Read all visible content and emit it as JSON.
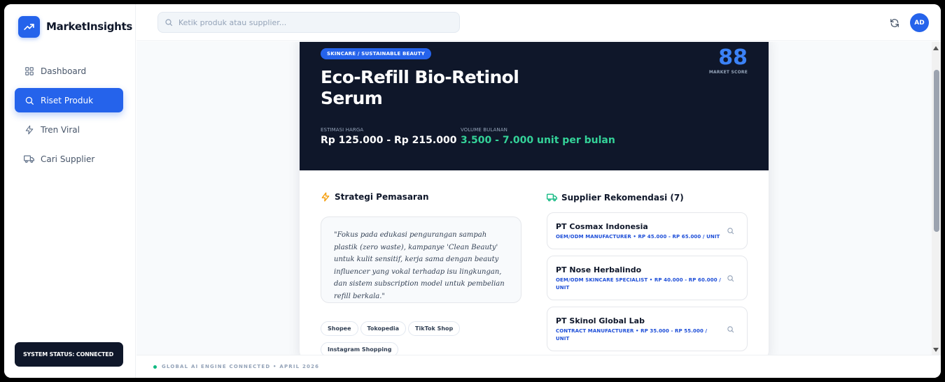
{
  "app": {
    "name": "MarketInsights"
  },
  "sidebar": {
    "items": [
      {
        "label": "Dashboard",
        "icon": "grid-icon",
        "active": false
      },
      {
        "label": "Riset Produk",
        "icon": "search-icon",
        "active": true
      },
      {
        "label": "Tren Viral",
        "icon": "lightning-icon",
        "active": false
      },
      {
        "label": "Cari Supplier",
        "icon": "truck-icon",
        "active": false
      }
    ],
    "system_status": "SYSTEM STATUS: CONNECTED"
  },
  "topbar": {
    "search_placeholder": "Ketik produk atau supplier...",
    "avatar_initials": "AD"
  },
  "product": {
    "category": "SKINCARE / SUSTAINABLE BEAUTY",
    "title": "Eco-Refill Bio-Retinol Serum",
    "market_score": "88",
    "market_score_label": "MARKET SCORE",
    "price_label": "ESTIMASI HARGA",
    "price_value": "Rp 125.000 - Rp 215.000",
    "volume_label": "VOLUME BULANAN",
    "volume_value": "3.500 - 7.000 unit per bulan"
  },
  "strategy": {
    "heading": "Strategi Pemasaran",
    "text": "\"Fokus pada edukasi pengurangan sampah plastik (zero waste), kampanye 'Clean Beauty' untuk kulit sensitif, kerja sama dengan beauty influencer yang vokal terhadap isu lingkungan, dan sistem subscription model untuk pembelian refill berkala.\"",
    "channels": [
      "Shopee",
      "Tokopedia",
      "TikTok Shop",
      "Instagram Shopping"
    ]
  },
  "suppliers": {
    "heading": "Supplier Rekomendasi (7)",
    "items": [
      {
        "name": "PT Cosmax Indonesia",
        "meta": "OEM/ODM MANUFACTURER • RP 45.000 - RP 65.000 / UNIT"
      },
      {
        "name": "PT Nose Herbalindo",
        "meta": "OEM/ODM SKINCARE SPECIALIST • RP 40.000 - RP 60.000 / UNIT"
      },
      {
        "name": "PT Skinol Global Lab",
        "meta": "CONTRACT MANUFACTURER • RP 35.000 - RP 55.000 / UNIT"
      }
    ]
  },
  "footer": {
    "text": "GLOBAL AI ENGINE CONNECTED • APRIL 2026"
  },
  "colors": {
    "accent": "#2563eb",
    "hero_bg": "#0f172a",
    "volume_green": "#34d399",
    "strategy_icon": "#f59e0b",
    "supplier_icon": "#10b981",
    "status_dot": "#10b981"
  }
}
